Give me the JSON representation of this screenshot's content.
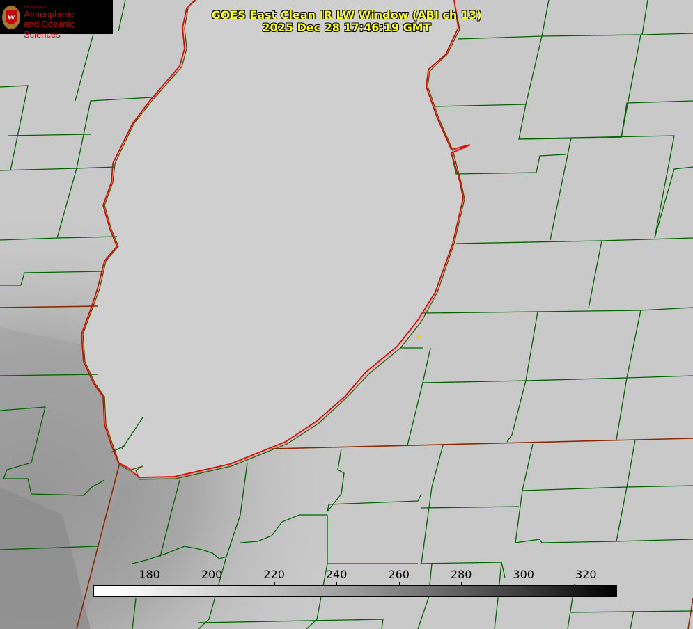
{
  "title": {
    "line1": "GOES East Clean IR LW Window (ABI ch 13)",
    "line2": "2025 Dec 28 17:46:19 GMT"
  },
  "logo": {
    "dept": "Department of",
    "line1": "Atmospheric",
    "line2": "and Oceanic Sciences",
    "seal_letter": "W"
  },
  "colorbar": {
    "ticks": [
      "180",
      "200",
      "220",
      "240",
      "260",
      "280",
      "300",
      "320"
    ],
    "tick_values": [
      180,
      200,
      220,
      240,
      260,
      280,
      300,
      320
    ],
    "range": [
      162,
      330
    ]
  },
  "colors": {
    "title": "#ffff1a",
    "county_lines": "#006400",
    "state_lines": "#8b2a00",
    "lake_outline": "#ff0000",
    "marker": "#e6d200"
  }
}
